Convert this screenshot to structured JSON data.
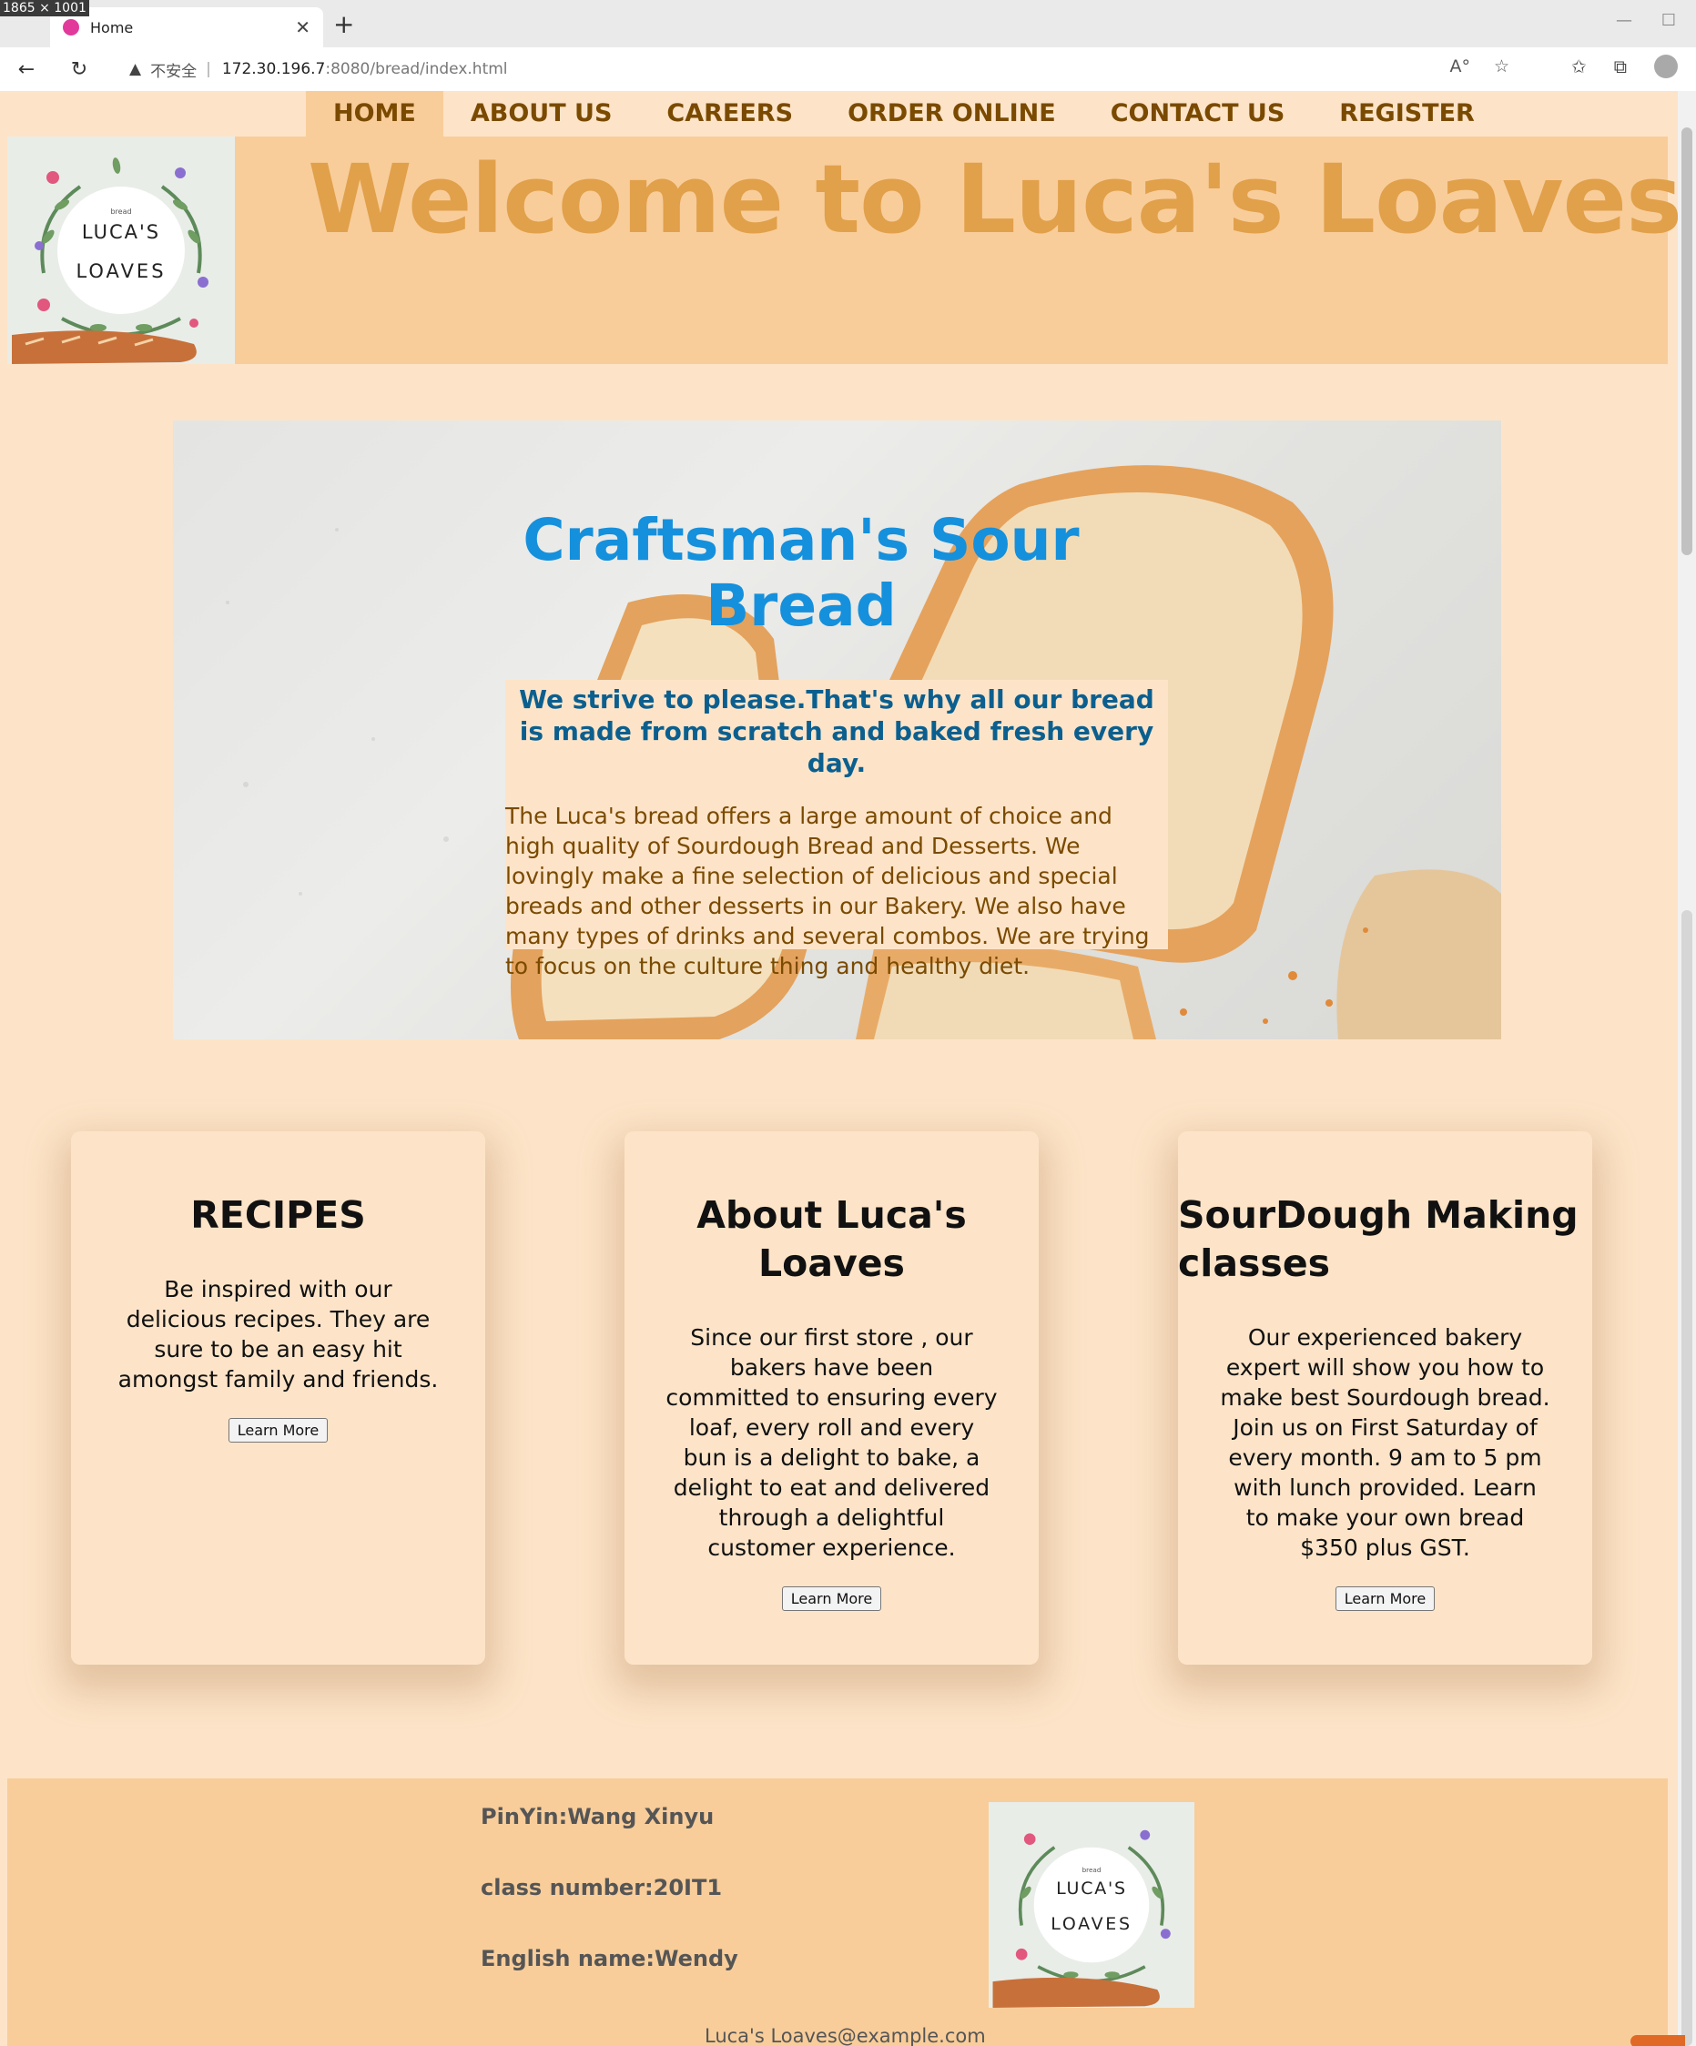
{
  "browser": {
    "dims_label": "1865 × 1001",
    "tab_title": "Home",
    "insecure_label": "不安全",
    "url_host": "172.30.196.7",
    "url_path": ":8080/bread/index.html"
  },
  "nav": {
    "items": [
      "HOME",
      "ABOUT US",
      "CAREERS",
      "ORDER ONLINE",
      "CONTACT US",
      "REGISTER"
    ],
    "active": "HOME"
  },
  "logo": {
    "small": "bread",
    "line1": "LUCA'S",
    "line2": "LOAVES"
  },
  "header": {
    "welcome": "Welcome to Luca's Loaves"
  },
  "hero": {
    "title": "Craftsman's Sour Bread",
    "subtitle": "We strive to please.That's why all our bread is made from scratch and baked fresh every day.",
    "body": "The Luca's bread offers a large amount of choice and high quality of Sourdough Bread and Desserts. We lovingly make a fine selection of delicious and special breads and other desserts in our Bakery. We also have many types of drinks and several combos. We are trying to focus on the culture thing and healthy diet."
  },
  "cards": [
    {
      "title": "RECIPES",
      "text": "Be inspired with our delicious recipes. They are sure to be an easy hit amongst family and friends.",
      "button": "Learn More"
    },
    {
      "title": "About Luca's Loaves",
      "text": "Since our first store , our bakers have been committed to ensuring every loaf, every roll and every bun is a delight to bake, a delight to eat and delivered through a delightful customer experience.",
      "button": "Learn More"
    },
    {
      "title": "SourDough Making classes",
      "text": "Our experienced bakery expert will show you how to make best Sourdough bread. Join us on First Saturday of every month. 9 am to 5 pm with lunch provided. Learn to make your own bread $350 plus GST.",
      "button": "Learn More"
    }
  ],
  "footer": {
    "pinyin": "PinYin:Wang Xinyu",
    "class_number": "class number:20IT1",
    "english_name": "English name:Wendy",
    "email": "Luca's Loaves@example.com"
  }
}
